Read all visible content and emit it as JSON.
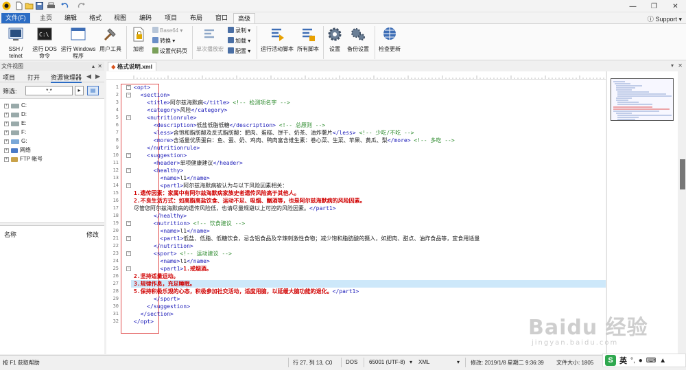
{
  "titlebar": {
    "window_controls": [
      "minimize-icon",
      "maximize-icon",
      "close-icon"
    ]
  },
  "ribbon_tabs": [
    "文件(F)",
    "主页",
    "编辑",
    "格式",
    "视图",
    "编码",
    "项目",
    "布局",
    "窗口",
    "高级"
  ],
  "active_tab": "高级",
  "support_label": "Support",
  "ribbon": {
    "ssh_label": "SSH / telnet",
    "dos_label": "运行 DOS 命令",
    "windows_label": "运行 Windows 程序",
    "tools_label": "用户工具",
    "encrypt_label": "加密",
    "base64_label": "Base64",
    "convert_label": "转换",
    "code_page_label": "设置代码页",
    "single_macro_label": "单次播放宏",
    "record_label": "录制",
    "load_label": "加载",
    "config_label": "配置",
    "run_script_label": "运行活动脚本",
    "all_scripts_label": "所有脚本",
    "settings_label": "设置",
    "backup_label": "备份设置",
    "update_label": "检查更新"
  },
  "left_panel": {
    "header": "文件视图",
    "tabs": [
      "项目",
      "打开",
      "资源管理器"
    ],
    "filter_label": "筛选:",
    "filter_value": "*.*",
    "tree": [
      "C:",
      "D:",
      "E:",
      "F:",
      "G:",
      "网络",
      "FTP 帐号"
    ],
    "props_name_label": "名称",
    "props_modified_label": "修改"
  },
  "document_tab": "格式说明.xml",
  "code_lines": [
    {
      "n": "1",
      "segs": [
        {
          "c": "tg",
          "t": "<opt>"
        }
      ]
    },
    {
      "n": "2",
      "segs": [
        {
          "c": "tg",
          "t": "  <section>"
        }
      ]
    },
    {
      "n": "3",
      "segs": [
        {
          "c": "tg",
          "t": "    <title>"
        },
        {
          "c": "",
          "t": "阿尔兹海默病"
        },
        {
          "c": "tg",
          "t": "</title>"
        },
        {
          "c": "cm",
          "t": " <!-- 检测项名字 -->"
        }
      ]
    },
    {
      "n": "4",
      "segs": [
        {
          "c": "tg",
          "t": "    <category>"
        },
        {
          "c": "",
          "t": "风险"
        },
        {
          "c": "tg",
          "t": "</category>"
        }
      ]
    },
    {
      "n": "5",
      "segs": [
        {
          "c": "tg",
          "t": "    <nutritionrule>"
        }
      ]
    },
    {
      "n": "6",
      "segs": [
        {
          "c": "tg",
          "t": "      <description>"
        },
        {
          "c": "",
          "t": "低盐低脂低糖"
        },
        {
          "c": "tg",
          "t": "</description>"
        },
        {
          "c": "cm",
          "t": " <!-- 总原则 -->"
        }
      ]
    },
    {
      "n": "7",
      "segs": [
        {
          "c": "tg",
          "t": "      <less>"
        },
        {
          "c": "",
          "t": "含饱和脂肪酸及反式脂肪酸：肥肉、蛋糕、饼干、奶茶、油炸薯片"
        },
        {
          "c": "tg",
          "t": "</less>"
        },
        {
          "c": "cm",
          "t": " <!-- 少吃/不吃 -->"
        }
      ]
    },
    {
      "n": "8",
      "segs": [
        {
          "c": "tg",
          "t": "      <more>"
        },
        {
          "c": "",
          "t": "含适量优质蛋白：鱼、蛋、奶、鸡肉、鸭肉富含维生素：卷心菜、生菜、苹果、黄瓜、梨"
        },
        {
          "c": "tg",
          "t": "</more>"
        },
        {
          "c": "cm",
          "t": " <!-- 多吃 -->"
        }
      ]
    },
    {
      "n": "9",
      "segs": [
        {
          "c": "tg",
          "t": "    </nutritionrule>"
        }
      ]
    },
    {
      "n": "10",
      "segs": [
        {
          "c": "tg",
          "t": "    <suggestion>"
        }
      ]
    },
    {
      "n": "11",
      "segs": [
        {
          "c": "tg",
          "t": "      <header>"
        },
        {
          "c": "",
          "t": "单项健康建议"
        },
        {
          "c": "tg",
          "t": "</header>"
        }
      ]
    },
    {
      "n": "12",
      "segs": [
        {
          "c": "tg",
          "t": "      <healthy>"
        }
      ]
    },
    {
      "n": "13",
      "segs": [
        {
          "c": "tg",
          "t": "        <name>"
        },
        {
          "c": "",
          "t": "l1"
        },
        {
          "c": "tg",
          "t": "</name>"
        }
      ]
    },
    {
      "n": "14",
      "segs": [
        {
          "c": "tg",
          "t": "        <part1>"
        },
        {
          "c": "",
          "t": "阿尔兹海默病被认为与以下风险因素相关："
        }
      ]
    },
    {
      "n": "15",
      "segs": [
        {
          "c": "rd",
          "t": "1.遗传因素：家属中有阿尔兹海默病家族史者遗传风险高于其他人。"
        }
      ]
    },
    {
      "n": "16",
      "segs": [
        {
          "c": "rd",
          "t": "2.不良生活方式：如高脂高盐饮食、运动不足、吸烟、酗酒等，也是阿尔兹海默病的风险因素。"
        }
      ]
    },
    {
      "n": "17",
      "segs": [
        {
          "c": "",
          "t": "尽管您阿尔兹海默病的遗传风险低，也请尽量规避以上可控的风险因素。"
        },
        {
          "c": "tg",
          "t": "</part1>"
        }
      ]
    },
    {
      "n": "18",
      "segs": [
        {
          "c": "tg",
          "t": "      </healthy>"
        }
      ]
    },
    {
      "n": "19",
      "segs": [
        {
          "c": "tg",
          "t": "      <nutrition>"
        },
        {
          "c": "cm",
          "t": " <!-- 饮食建议 -->"
        }
      ]
    },
    {
      "n": "20",
      "segs": [
        {
          "c": "tg",
          "t": "        <name>"
        },
        {
          "c": "",
          "t": "l1"
        },
        {
          "c": "tg",
          "t": "</name>"
        }
      ]
    },
    {
      "n": "21",
      "segs": [
        {
          "c": "tg",
          "t": "        <part1>"
        },
        {
          "c": "",
          "t": "低盐、低脂、低糖饮食，忌含铝食品及辛辣刺激性食物；减少饱和脂肪酸的摄入，如肥肉、甜点、油炸食品等，宜食用适量"
        }
      ]
    },
    {
      "n": "22",
      "segs": [
        {
          "c": "tg",
          "t": "      </nutrition>"
        }
      ]
    },
    {
      "n": "23",
      "segs": [
        {
          "c": "tg",
          "t": "      <sport>"
        },
        {
          "c": "cm",
          "t": " <!-- 运动建议 -->"
        }
      ]
    },
    {
      "n": "24",
      "segs": [
        {
          "c": "tg",
          "t": "        <name>"
        },
        {
          "c": "",
          "t": "l1"
        },
        {
          "c": "tg",
          "t": "</name>"
        }
      ]
    },
    {
      "n": "25",
      "segs": [
        {
          "c": "tg",
          "t": "        <part1>"
        },
        {
          "c": "rd",
          "t": "1.戒烟酒。"
        }
      ]
    },
    {
      "n": "26",
      "segs": [
        {
          "c": "rd",
          "t": "2.坚持适量运动。"
        }
      ]
    },
    {
      "n": "27",
      "segs": [
        {
          "c": "rd",
          "t": "3.规律作息，充足睡眠。"
        }
      ]
    },
    {
      "n": "28",
      "segs": [
        {
          "c": "rd",
          "t": "5.保持积极乐观的心态，积极参加社交活动，适度用脑，以延缓大脑功能的退化。"
        },
        {
          "c": "tg",
          "t": "</part1>"
        }
      ]
    },
    {
      "n": "29",
      "segs": [
        {
          "c": "tg",
          "t": "      </sport>"
        }
      ]
    },
    {
      "n": "30",
      "segs": [
        {
          "c": "tg",
          "t": "    </suggestion>"
        }
      ]
    },
    {
      "n": "31",
      "segs": [
        {
          "c": "tg",
          "t": "  </section>"
        }
      ]
    },
    {
      "n": "32",
      "segs": [
        {
          "c": "tg",
          "t": "</opt>"
        }
      ]
    }
  ],
  "status": {
    "help": "按 F1 获取帮助",
    "position": "行 27, 列 13, C0",
    "line_ending": "DOS",
    "encoding": "65001 (UTF-8)",
    "syntax": "XML",
    "modified": "修改:   2019/1/8 星期二 9:36:39",
    "file_size": "文件大小: 1805"
  },
  "ime": {
    "lang": "英"
  },
  "watermark": {
    "text": "Baidu 经验",
    "sub": "jingyan.baidu.com"
  }
}
